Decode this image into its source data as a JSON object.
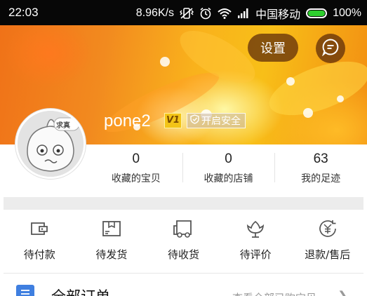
{
  "status_bar": {
    "time": "22:03",
    "speed": "8.96K/s",
    "carrier": "中国移动",
    "battery": "100%",
    "icons": [
      "vibrate-icon",
      "alarm-icon",
      "wifi-icon",
      "signal-icon",
      "battery-icon"
    ]
  },
  "header": {
    "settings_label": "设置",
    "message_icon": "chat-bubble-icon",
    "username": "pone2",
    "vip_badge": "V1",
    "security_label": "开启安全",
    "security_icon": "shield-icon",
    "avatar_text": "求真",
    "accent_color": "#f29a1a"
  },
  "stats": [
    {
      "value": "0",
      "label": "收藏的宝贝"
    },
    {
      "value": "0",
      "label": "收藏的店铺"
    },
    {
      "value": "63",
      "label": "我的足迹"
    }
  ],
  "orders": [
    {
      "label": "待付款",
      "icon": "wallet-icon"
    },
    {
      "label": "待发货",
      "icon": "package-icon"
    },
    {
      "label": "待收货",
      "icon": "truck-icon"
    },
    {
      "label": "待评价",
      "icon": "flower-icon"
    },
    {
      "label": "退款/售后",
      "icon": "refund-icon"
    }
  ],
  "all_orders": {
    "label": "全部订单",
    "link": "查看全部已购宝贝",
    "icon": "order-list-icon",
    "icon_color": "#3f7fe0"
  }
}
